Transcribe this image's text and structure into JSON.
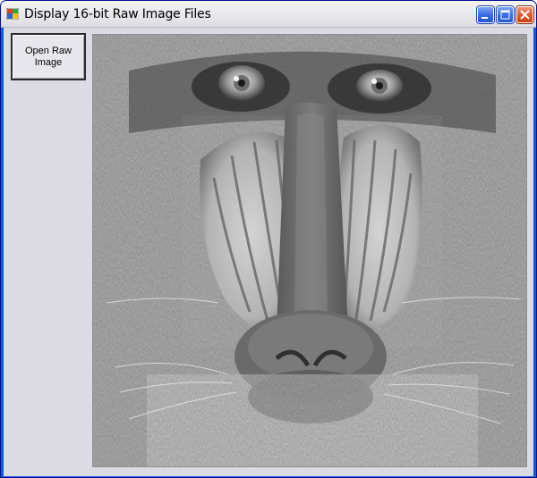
{
  "window": {
    "title": "Display 16-bit Raw Image Files",
    "icon": "windows-app-icon",
    "controls": [
      "minimize-icon",
      "maximize-icon",
      "close-icon"
    ],
    "colors": {
      "frame": "#0a5cd8",
      "client_background": "#dcdbe3",
      "close_button": "#e05a32"
    }
  },
  "toolbar": {
    "open_raw_label_line1": "Open Raw",
    "open_raw_label_line2": "Image"
  },
  "image": {
    "description_name": "grayscale-raw-image",
    "colormap": "grayscale"
  }
}
